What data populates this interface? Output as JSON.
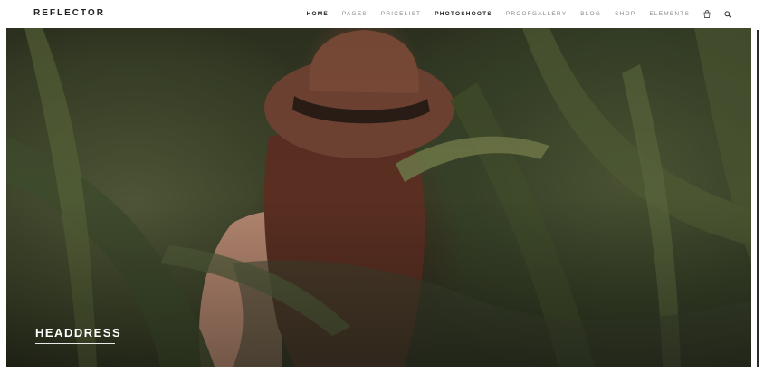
{
  "header": {
    "logo": "REFLECTOR",
    "nav": [
      {
        "label": "HOME"
      },
      {
        "label": "PAGES"
      },
      {
        "label": "PRICELIST"
      },
      {
        "label": "PHOTOSHOOTS"
      },
      {
        "label": "PROOFGALLERY"
      },
      {
        "label": "BLOG"
      },
      {
        "label": "SHOP"
      },
      {
        "label": "ELEMENTS"
      }
    ],
    "icons": [
      "shopping-bag-icon",
      "search-icon"
    ]
  },
  "hero": {
    "title": "HEADDRESS"
  },
  "colors": {
    "text_dark": "#222222",
    "text_muted": "#8a8a8a",
    "background": "#ffffff"
  }
}
